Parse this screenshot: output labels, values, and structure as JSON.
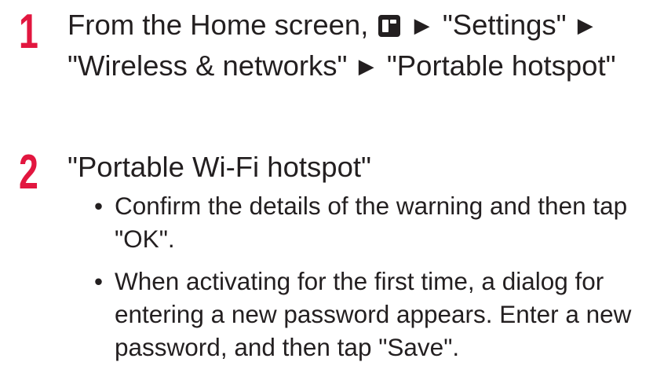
{
  "steps": [
    {
      "number": "1",
      "text_parts": {
        "p1": "From the Home screen, ",
        "p2": "\"Settings\"",
        "p3": "\"Wireless & networks\"",
        "p4": "\"Portable hotspot\""
      },
      "icon": "home-app-key-icon",
      "separator": "▶"
    },
    {
      "number": "2",
      "text": "\"Portable Wi-Fi hotspot\"",
      "bullets": [
        "Confirm the details of the warning and then tap \"OK\".",
        "When activating for the first time, a dialog for entering a new password appears. Enter a new password, and then tap \"Save\"."
      ],
      "bullet_symbol": "•"
    }
  ],
  "colors": {
    "step_number": "#e2163f",
    "text": "#231f20",
    "background": "#ffffff"
  }
}
